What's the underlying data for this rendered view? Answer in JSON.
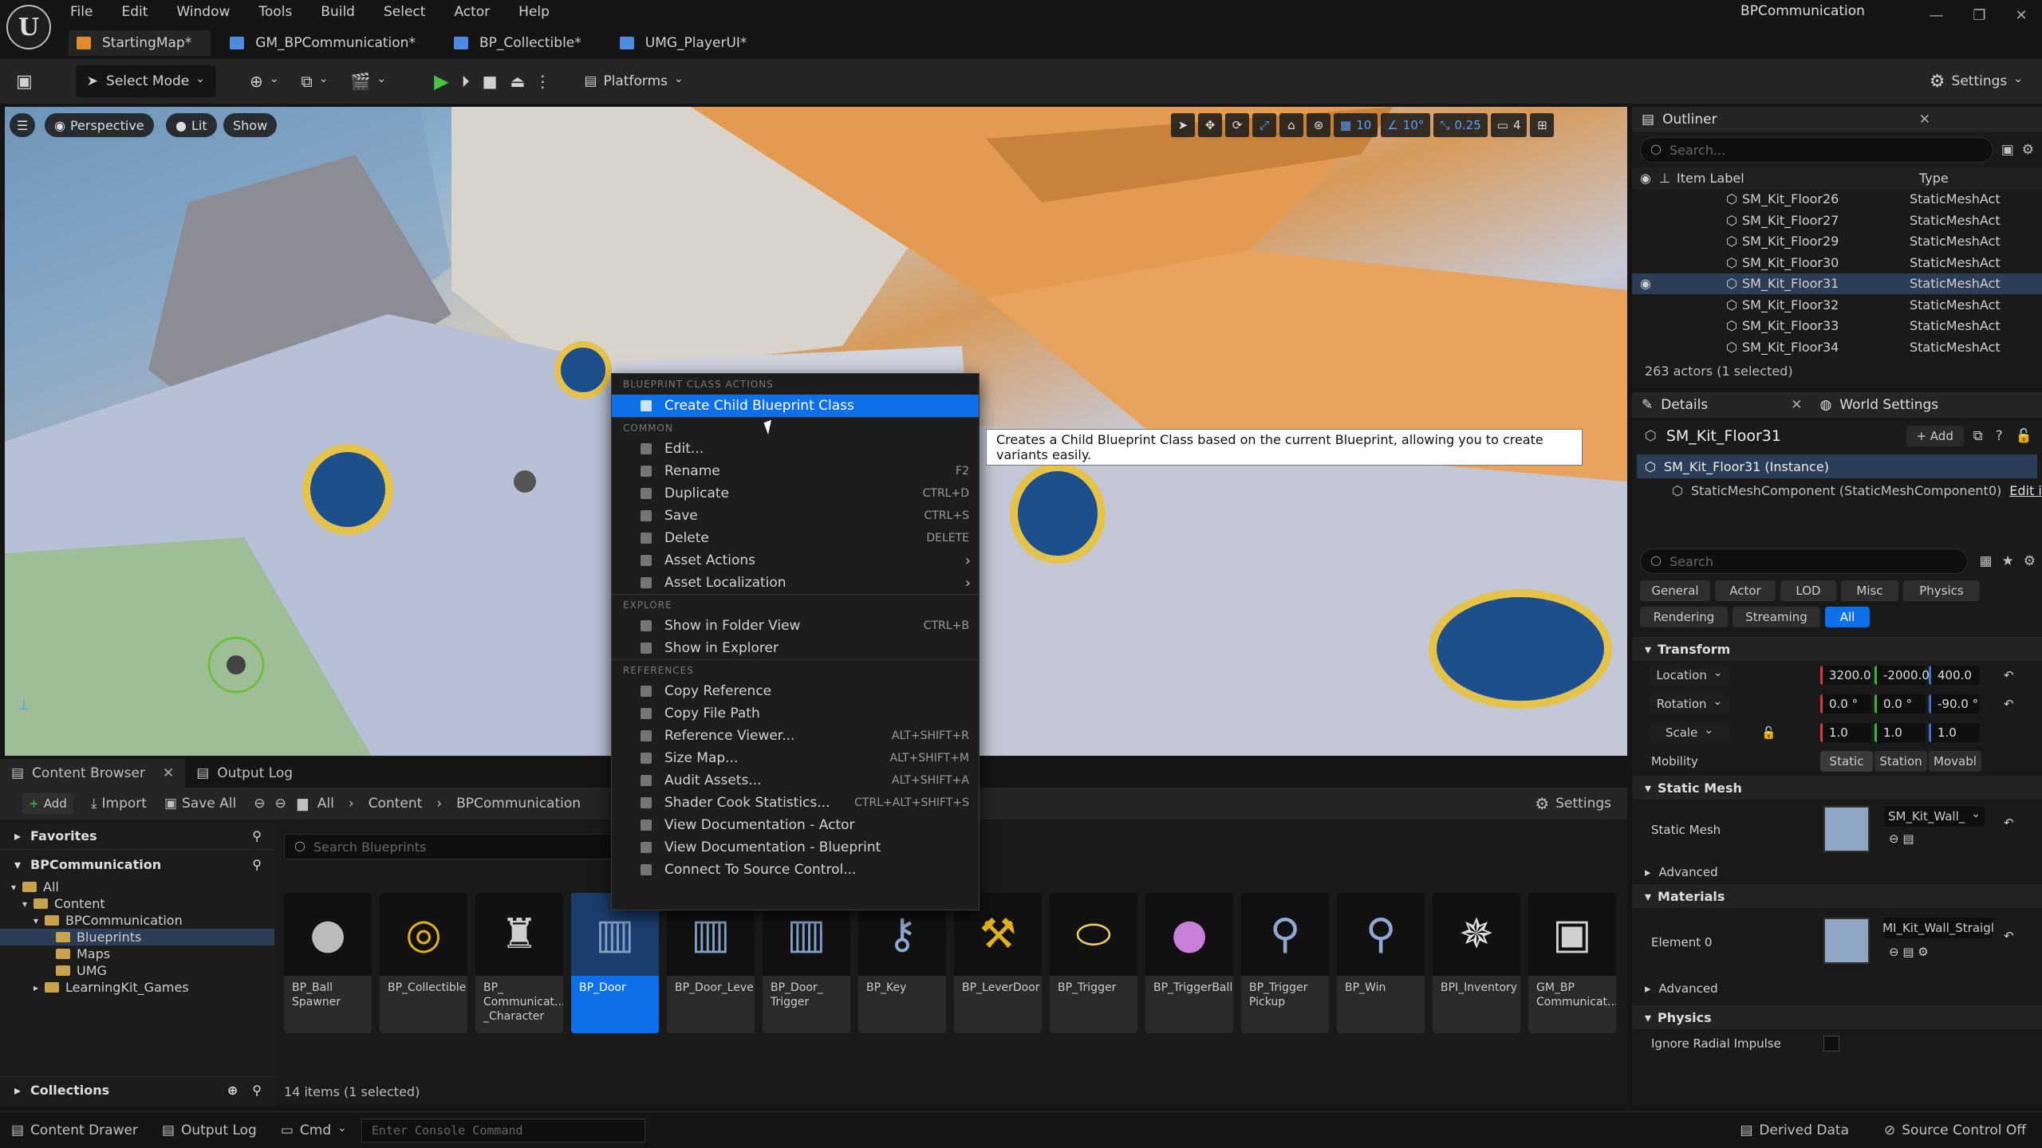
{
  "app": {
    "logo": "U",
    "project": "BPCommunication",
    "window_controls": [
      "—",
      "❐",
      "✕"
    ]
  },
  "menu": [
    "File",
    "Edit",
    "Window",
    "Tools",
    "Build",
    "Select",
    "Actor",
    "Help"
  ],
  "tabs": [
    {
      "label": "StartingMap*",
      "color": "#e08a2c"
    },
    {
      "label": "GM_BPCommunication*",
      "color": "#4c8be0"
    },
    {
      "label": "BP_Collectible*",
      "color": "#4c8be0"
    },
    {
      "label": "UMG_PlayerUI*",
      "color": "#4c8be0"
    }
  ],
  "toolbar": {
    "select_mode": "Select Mode",
    "platforms": "Platforms",
    "settings": "Settings"
  },
  "viewport": {
    "perspective": "Perspective",
    "lit": "Lit",
    "show": "Show",
    "grid_snap": "10",
    "rot_snap": "10°",
    "scale_snap": "0.25",
    "cam_speed": "4"
  },
  "outliner": {
    "title": "Outliner",
    "search_placeholder": "Search...",
    "col_label": "Item Label",
    "col_type": "Type",
    "items": [
      {
        "label": "SM_Kit_Floor26",
        "type": "StaticMeshAct"
      },
      {
        "label": "SM_Kit_Floor27",
        "type": "StaticMeshAct"
      },
      {
        "label": "SM_Kit_Floor29",
        "type": "StaticMeshAct"
      },
      {
        "label": "SM_Kit_Floor30",
        "type": "StaticMeshAct"
      },
      {
        "label": "SM_Kit_Floor31",
        "type": "StaticMeshAct"
      },
      {
        "label": "SM_Kit_Floor32",
        "type": "StaticMeshAct"
      },
      {
        "label": "SM_Kit_Floor33",
        "type": "StaticMeshAct"
      },
      {
        "label": "SM_Kit_Floor34",
        "type": "StaticMeshAct"
      }
    ],
    "footer": "263 actors (1 selected)"
  },
  "details": {
    "tab": "Details",
    "world_tab": "World Settings",
    "actor": "SM_Kit_Floor31",
    "add": "Add",
    "instance": "SM_Kit_Floor31 (Instance)",
    "component": "StaticMeshComponent (StaticMeshComponent0)",
    "edit_link": "Edit i",
    "search_placeholder": "Search",
    "filters": [
      "General",
      "Actor",
      "LOD",
      "Misc",
      "Physics"
    ],
    "filters2": [
      "Rendering",
      "Streaming",
      "All"
    ],
    "transform": "Transform",
    "location_label": "Location",
    "location": [
      "3200.0",
      "-2000.0",
      "400.0"
    ],
    "rotation_label": "Rotation",
    "rotation": [
      "0.0 °",
      "0.0 °",
      "-90.0 °"
    ],
    "scale_label": "Scale",
    "scale": [
      "1.0",
      "1.0",
      "1.0"
    ],
    "mobility_label": "Mobility",
    "mobility": [
      "Static",
      "Station",
      "Movabl"
    ],
    "static_mesh_sec": "Static Mesh",
    "static_mesh_label": "Static Mesh",
    "static_mesh_value": "SM_Kit_Wall_",
    "advanced": "Advanced",
    "materials": "Materials",
    "element0": "Element 0",
    "material_value": "MI_Kit_Wall_Straigl",
    "advanced2": "Advanced",
    "physics": "Physics",
    "ignore_radial": "Ignore Radial Impulse"
  },
  "content_browser": {
    "tab": "Content Browser",
    "output_tab": "Output Log",
    "add": "Add",
    "import": "Import",
    "save_all": "Save All",
    "path": [
      "All",
      "Content",
      "BPCommunication"
    ],
    "settings": "Settings",
    "favorites": "Favorites",
    "root": "BPCommunication",
    "tree": [
      {
        "label": "All",
        "indent": 0
      },
      {
        "label": "Content",
        "indent": 1
      },
      {
        "label": "BPCommunication",
        "indent": 2
      },
      {
        "label": "Blueprints",
        "indent": 3
      },
      {
        "label": "Maps",
        "indent": 3
      },
      {
        "label": "UMG",
        "indent": 3
      },
      {
        "label": "LearningKit_Games",
        "indent": 2
      }
    ],
    "collections": "Collections",
    "search_placeholder": "Search Blueprints",
    "assets": [
      {
        "name": "BP_Ball Spawner",
        "glyph": "●",
        "color": "#bbbbbb"
      },
      {
        "name": "BP_Collectible",
        "glyph": "◎",
        "color": "#e0b020"
      },
      {
        "name": "BP_ Communicat... _Character",
        "glyph": "♜",
        "color": "#cfcfcf"
      },
      {
        "name": "BP_Door",
        "glyph": "▥",
        "color": "#7fa0c8"
      },
      {
        "name": "BP_Door_Lever",
        "glyph": "▥",
        "color": "#7fa0c8"
      },
      {
        "name": "BP_Door_ Trigger",
        "glyph": "▥",
        "color": "#7fa0c8"
      },
      {
        "name": "BP_Key",
        "glyph": "⚷",
        "color": "#8fa8d0"
      },
      {
        "name": "BP_LeverDoor",
        "glyph": "⚒",
        "color": "#e0b020"
      },
      {
        "name": "BP_Trigger",
        "glyph": "⬭",
        "color": "#f0d060"
      },
      {
        "name": "BP_TriggerBall",
        "glyph": "●",
        "color": "#c77fd8"
      },
      {
        "name": "BP_Trigger Pickup",
        "glyph": "⚲",
        "color": "#8fa8d0"
      },
      {
        "name": "BP_Win",
        "glyph": "⚲",
        "color": "#8fa8d0"
      },
      {
        "name": "BPI_Inventory",
        "glyph": "✵",
        "color": "#e0e0e0"
      },
      {
        "name": "GM_BP Communicat...",
        "glyph": "▣",
        "color": "#d0d0d0"
      }
    ],
    "count": "14 items (1 selected)"
  },
  "context_menu": {
    "sections": [
      {
        "header": "BLUEPRINT CLASS ACTIONS",
        "items": [
          {
            "label": "Create Child Blueprint Class",
            "shortcut": "",
            "highlight": true
          }
        ]
      },
      {
        "header": "COMMON",
        "items": [
          {
            "label": "Edit...",
            "shortcut": ""
          },
          {
            "label": "Rename",
            "shortcut": "F2"
          },
          {
            "label": "Duplicate",
            "shortcut": "CTRL+D"
          },
          {
            "label": "Save",
            "shortcut": "CTRL+S"
          },
          {
            "label": "Delete",
            "shortcut": "DELETE"
          },
          {
            "label": "Asset Actions",
            "shortcut": "",
            "submenu": true
          },
          {
            "label": "Asset Localization",
            "shortcut": "",
            "submenu": true
          }
        ]
      },
      {
        "header": "EXPLORE",
        "items": [
          {
            "label": "Show in Folder View",
            "shortcut": "CTRL+B"
          },
          {
            "label": "Show in Explorer",
            "shortcut": ""
          }
        ]
      },
      {
        "header": "REFERENCES",
        "items": [
          {
            "label": "Copy Reference",
            "shortcut": ""
          },
          {
            "label": "Copy File Path",
            "shortcut": ""
          },
          {
            "label": "Reference Viewer...",
            "shortcut": "ALT+SHIFT+R"
          },
          {
            "label": "Size Map...",
            "shortcut": "ALT+SHIFT+M"
          },
          {
            "label": "Audit Assets...",
            "shortcut": "ALT+SHIFT+A"
          },
          {
            "label": "Shader Cook Statistics...",
            "shortcut": "CTRL+ALT+SHIFT+S"
          },
          {
            "label": "View Documentation - Actor",
            "shortcut": ""
          },
          {
            "label": "View Documentation - Blueprint",
            "shortcut": ""
          },
          {
            "label": "Connect To Source Control...",
            "shortcut": ""
          }
        ]
      }
    ]
  },
  "tooltip": "Creates a Child Blueprint Class based on the current Blueprint, allowing you to create variants easily.",
  "statusbar": {
    "drawer": "Content Drawer",
    "output": "Output Log",
    "cmd": "Cmd",
    "console_placeholder": "Enter Console Command",
    "derived": "Derived Data",
    "source_control": "Source Control Off"
  }
}
